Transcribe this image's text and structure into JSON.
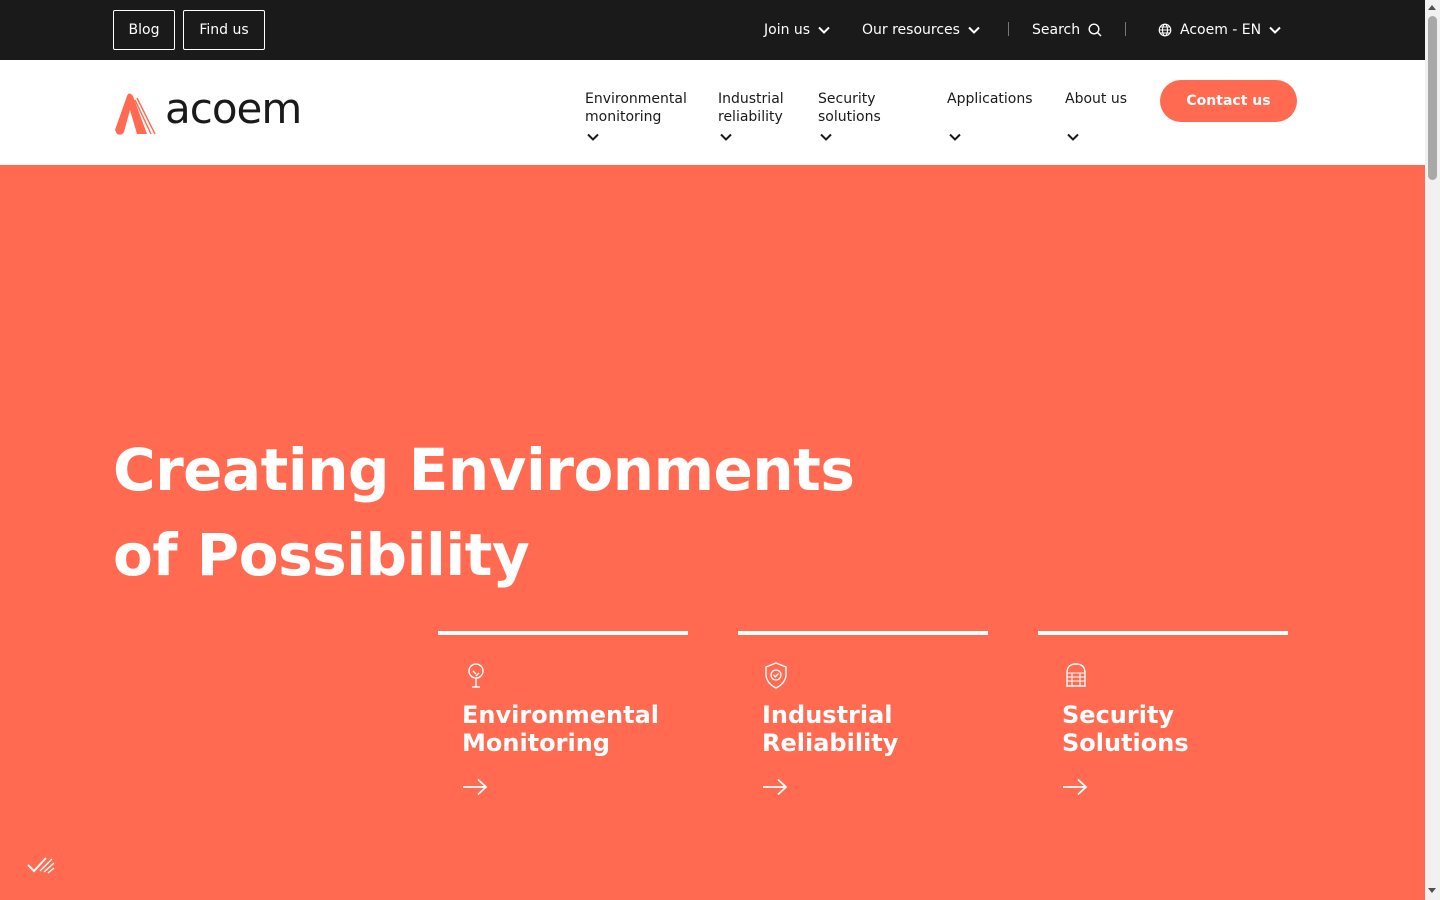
{
  "topbar": {
    "blog": "Blog",
    "find_us": "Find us",
    "join_us": "Join us",
    "resources": "Our resources",
    "search": "Search",
    "language": "Acoem - EN"
  },
  "header": {
    "logo_text": "acoem",
    "nav": [
      {
        "label": "Environmental monitoring"
      },
      {
        "label": "Industrial reliability"
      },
      {
        "label": "Security solutions"
      },
      {
        "label": "Applications"
      },
      {
        "label": "About us"
      }
    ],
    "contact": "Contact us"
  },
  "hero": {
    "title_line1": "Creating Environments",
    "title_line2": "of Possibility",
    "cards": [
      {
        "title_l1": "Environmental",
        "title_l2": "Monitoring",
        "icon": "tree-icon"
      },
      {
        "title_l1": "Industrial",
        "title_l2": "Reliability",
        "icon": "shield-check-icon"
      },
      {
        "title_l1": "Security",
        "title_l2": "Solutions",
        "icon": "security-device-icon"
      }
    ]
  },
  "colors": {
    "brand": "#ff6a50",
    "topbar_bg": "#1a1a1a",
    "header_bg": "#ffffff"
  }
}
